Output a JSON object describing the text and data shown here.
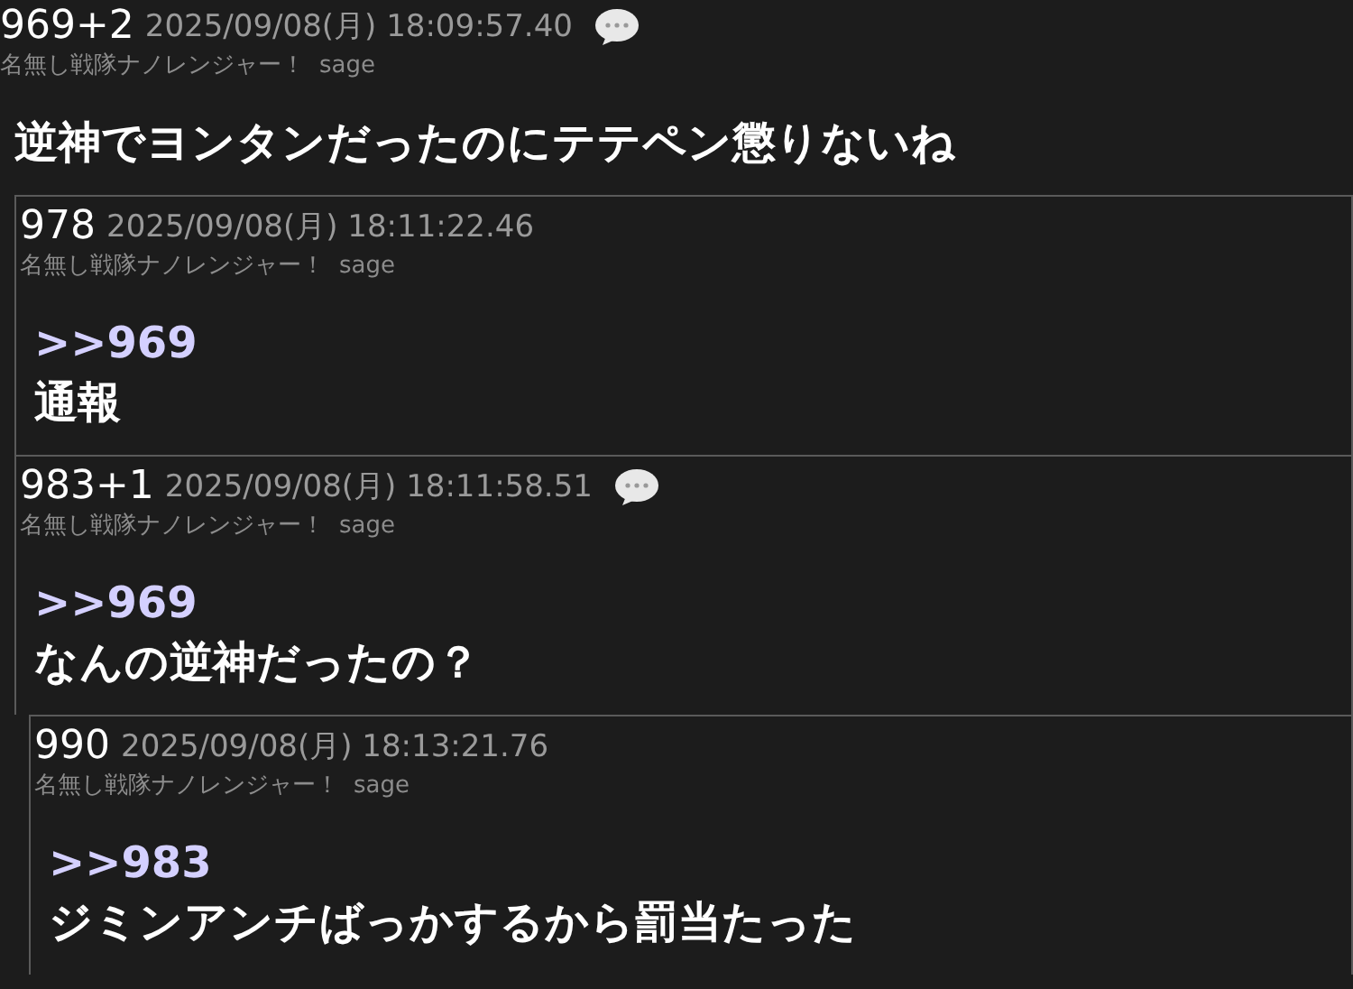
{
  "posts": [
    {
      "number": "969+2",
      "date": "2025/09/08(月) 18:09:57.40",
      "reply_icon": true,
      "name": "名無し戦隊ナノレンジャー！",
      "mail": "sage",
      "body": "逆神でヨンタンだったのにテテペン懲りないね",
      "children": [
        {
          "number": "978",
          "date": "2025/09/08(月) 18:11:22.46",
          "reply_icon": false,
          "name": "名無し戦隊ナノレンジャー！",
          "mail": "sage",
          "anchor": ">>969",
          "body": "通報"
        },
        {
          "number": "983+1",
          "date": "2025/09/08(月) 18:11:58.51",
          "reply_icon": true,
          "name": "名無し戦隊ナノレンジャー！",
          "mail": "sage",
          "anchor": ">>969",
          "body": "なんの逆神だったの？",
          "children": [
            {
              "number": "990",
              "date": "2025/09/08(月) 18:13:21.76",
              "reply_icon": false,
              "name": "名無し戦隊ナノレンジャー！",
              "mail": "sage",
              "anchor": ">>983",
              "body": "ジミンアンチばっかするから罰当たった"
            }
          ]
        }
      ]
    }
  ]
}
